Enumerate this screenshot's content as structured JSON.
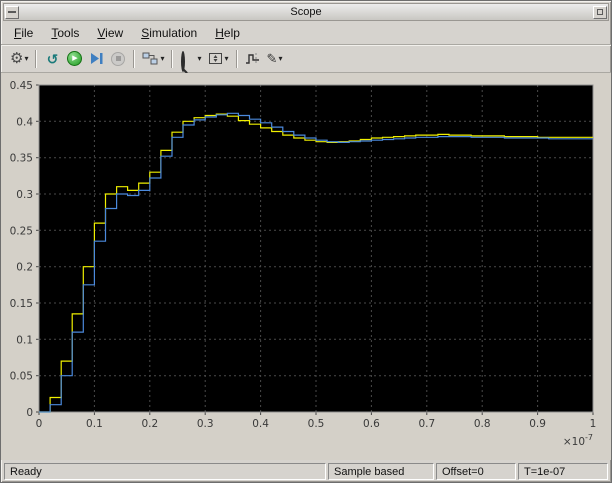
{
  "window": {
    "title": "Scope"
  },
  "menu": {
    "items": [
      {
        "label": "File"
      },
      {
        "label": "Tools"
      },
      {
        "label": "View"
      },
      {
        "label": "Simulation"
      },
      {
        "label": "Help"
      }
    ]
  },
  "toolbar": {
    "gear_glyph": "⚙",
    "dropdown_glyph": "▾",
    "stepping_glyph": "↺",
    "play_glyph": "▶",
    "pencil_glyph": "✎",
    "buttons": [
      "settings-gear",
      "stepping-options",
      "run",
      "step-forward",
      "stop",
      "signal-selector",
      "zoom",
      "span-axes",
      "cursor-measurements",
      "style-brush"
    ]
  },
  "status_bar": {
    "ready": "Ready",
    "sample": "Sample based",
    "offset": "Offset=0",
    "time": "T=1e-07"
  },
  "chart_data": {
    "type": "line",
    "title": "",
    "xlabel": "",
    "ylabel": "",
    "interpolation": "step",
    "grid": true,
    "legend": "none",
    "background": "#000000",
    "grid_color": "#4a4a4a",
    "xlim": [
      0,
      1
    ],
    "ylim": [
      0,
      0.45
    ],
    "xticks": [
      0,
      0.1,
      0.2,
      0.3,
      0.4,
      0.5,
      0.6,
      0.7,
      0.8,
      0.9,
      1
    ],
    "yticks": [
      0,
      0.05,
      0.1,
      0.15,
      0.2,
      0.25,
      0.3,
      0.35,
      0.4,
      0.45
    ],
    "x_scale_label": {
      "prefix": "×10",
      "exp": "-7"
    },
    "series": [
      {
        "name": "signal-yellow",
        "color": "#f0f000",
        "x": [
          0,
          0.02,
          0.04,
          0.06,
          0.08,
          0.1,
          0.12,
          0.14,
          0.16,
          0.18,
          0.2,
          0.22,
          0.24,
          0.26,
          0.28,
          0.3,
          0.32,
          0.34,
          0.36,
          0.38,
          0.4,
          0.42,
          0.44,
          0.46,
          0.48,
          0.5,
          0.52,
          0.54,
          0.56,
          0.58,
          0.6,
          0.62,
          0.64,
          0.66,
          0.68,
          0.7,
          0.72,
          0.74,
          0.76,
          0.78,
          0.8,
          0.82,
          0.84,
          0.86,
          0.88,
          0.9,
          0.92,
          0.94,
          0.96,
          0.98,
          1
        ],
        "y": [
          0,
          0.02,
          0.07,
          0.135,
          0.2,
          0.26,
          0.3,
          0.31,
          0.305,
          0.315,
          0.33,
          0.36,
          0.385,
          0.4,
          0.405,
          0.408,
          0.41,
          0.407,
          0.401,
          0.396,
          0.391,
          0.386,
          0.381,
          0.377,
          0.374,
          0.372,
          0.371,
          0.372,
          0.373,
          0.375,
          0.377,
          0.378,
          0.379,
          0.38,
          0.381,
          0.381,
          0.382,
          0.381,
          0.381,
          0.38,
          0.38,
          0.38,
          0.379,
          0.379,
          0.379,
          0.378,
          0.378,
          0.378,
          0.378,
          0.378,
          0.378
        ]
      },
      {
        "name": "signal-blue",
        "color": "#4b89dc",
        "x": [
          0,
          0.02,
          0.04,
          0.06,
          0.08,
          0.1,
          0.12,
          0.14,
          0.16,
          0.18,
          0.2,
          0.22,
          0.24,
          0.26,
          0.28,
          0.3,
          0.32,
          0.34,
          0.36,
          0.38,
          0.4,
          0.42,
          0.44,
          0.46,
          0.48,
          0.5,
          0.52,
          0.54,
          0.56,
          0.58,
          0.6,
          0.62,
          0.64,
          0.66,
          0.68,
          0.7,
          0.72,
          0.74,
          0.76,
          0.78,
          0.8,
          0.82,
          0.84,
          0.86,
          0.88,
          0.9,
          0.92,
          0.94,
          0.96,
          0.98,
          1
        ],
        "y": [
          0,
          0.01,
          0.05,
          0.11,
          0.175,
          0.235,
          0.28,
          0.3,
          0.298,
          0.305,
          0.322,
          0.352,
          0.378,
          0.395,
          0.402,
          0.406,
          0.409,
          0.411,
          0.408,
          0.403,
          0.398,
          0.392,
          0.386,
          0.381,
          0.377,
          0.374,
          0.372,
          0.371,
          0.372,
          0.373,
          0.374,
          0.375,
          0.376,
          0.377,
          0.378,
          0.378,
          0.379,
          0.379,
          0.379,
          0.378,
          0.378,
          0.378,
          0.377,
          0.377,
          0.377,
          0.377,
          0.376,
          0.376,
          0.376,
          0.376,
          0.376
        ]
      }
    ]
  }
}
